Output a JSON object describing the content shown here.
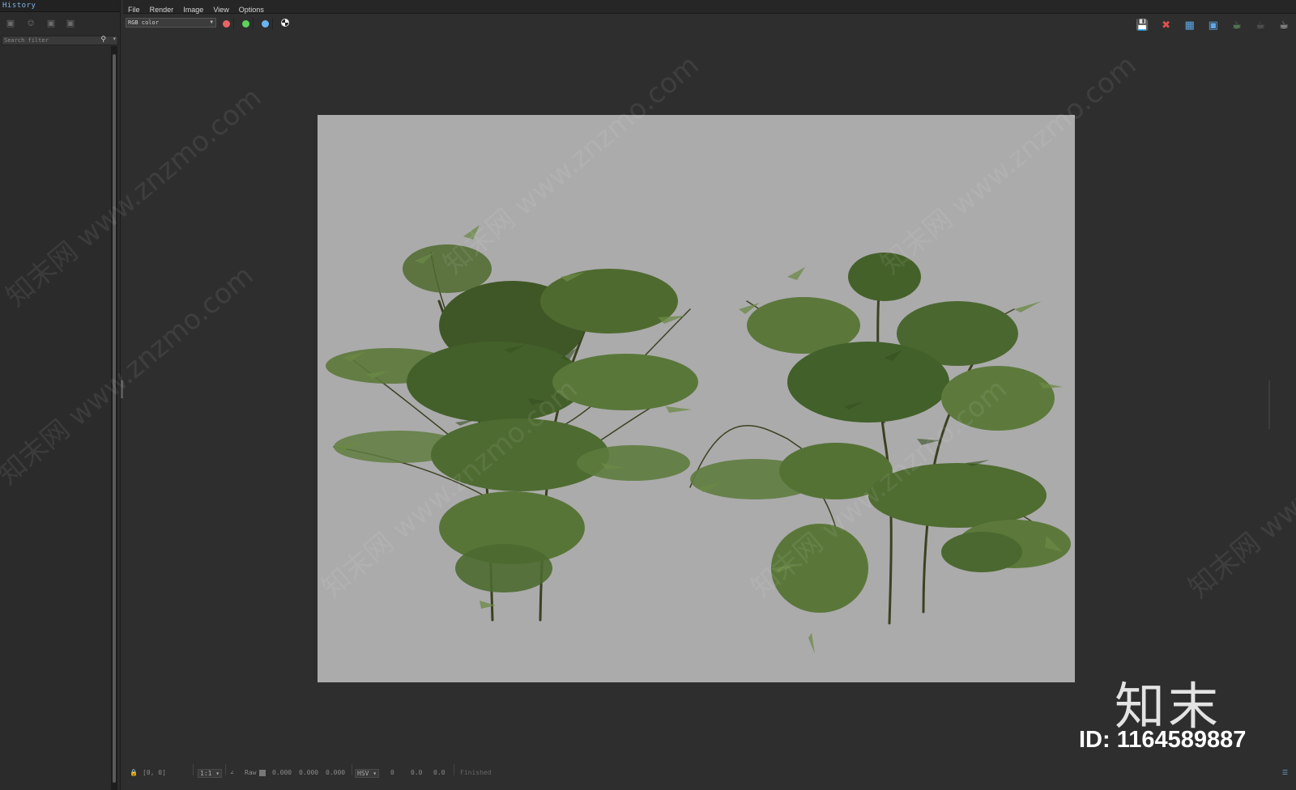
{
  "history_panel": {
    "title": "History",
    "search_placeholder": "Search filter",
    "tools": [
      "save-icon",
      "compare-icon",
      "load-icon",
      "remove-icon"
    ]
  },
  "menu": [
    "File",
    "Render",
    "Image",
    "View",
    "Options"
  ],
  "toolbar": {
    "channel": "RGB color",
    "channel_buttons": [
      {
        "name": "red-channel-icon",
        "color": "#e86464"
      },
      {
        "name": "green-channel-icon",
        "color": "#5bd45b"
      },
      {
        "name": "blue-channel-icon",
        "color": "#6ab4f0"
      }
    ],
    "right_tools": [
      "save-image-icon",
      "clear-image-icon",
      "region-render-icon",
      "track-mouse-icon",
      "render-icon",
      "render-last-icon",
      "teapot-icon"
    ]
  },
  "viewport": {
    "background": "#2e2e2e",
    "render_background": "#ababab",
    "render_content": "two-bamboo-plants"
  },
  "statusbar": {
    "coords": "[0, 0]",
    "zoom": "1:1",
    "raw_label": "Raw",
    "raw_values": [
      "0.000",
      "0.000",
      "0.000"
    ],
    "color_mode": "HSV",
    "hsv_values": [
      "0",
      "0.0",
      "0.0"
    ],
    "status": "Finished"
  },
  "watermark": {
    "text": "知末网 www.znzmo.com",
    "logo": "知末",
    "id_text": "ID: 1164589887"
  }
}
